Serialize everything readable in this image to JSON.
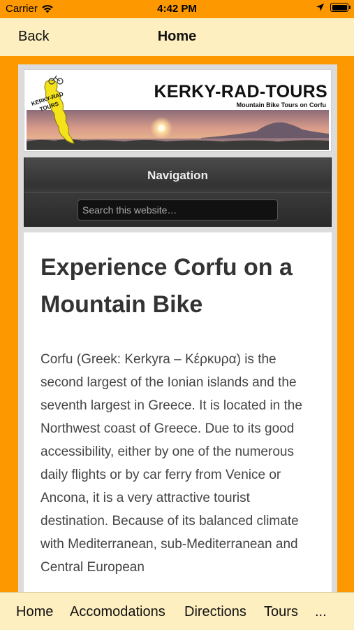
{
  "status": {
    "carrier": "Carrier",
    "time": "4:42 PM"
  },
  "navbar": {
    "back_label": "Back",
    "title": "Home"
  },
  "site": {
    "title": "KERKY-RAD-TOURS",
    "subtitle": "Mountain Bike Tours on Corfu",
    "logo_text": "KERKY-RAD TOURS"
  },
  "navigation": {
    "label": "Navigation",
    "search_placeholder": "Search this website…"
  },
  "article": {
    "heading": "Experience Corfu on a Mountain Bike",
    "body": "Corfu (Greek: Kerkyra – Κέρκυρα) is the second largest of the Ionian islands and the seventh largest in Greece. It is located in the Northwest coast of Greece. Due to its good accessibility, either by one of the numerous daily flights or by car ferry from Venice or Ancona, it is a very attractive tourist destination. Because of its balanced climate with Mediterranean, sub-Mediterranean and Central European"
  },
  "tabs": [
    {
      "label": "Home"
    },
    {
      "label": "Accomodations"
    },
    {
      "label": "Directions"
    },
    {
      "label": "Tours"
    },
    {
      "label": "..."
    }
  ],
  "colors": {
    "accent": "#fd9800",
    "bar": "#fdefbf"
  }
}
